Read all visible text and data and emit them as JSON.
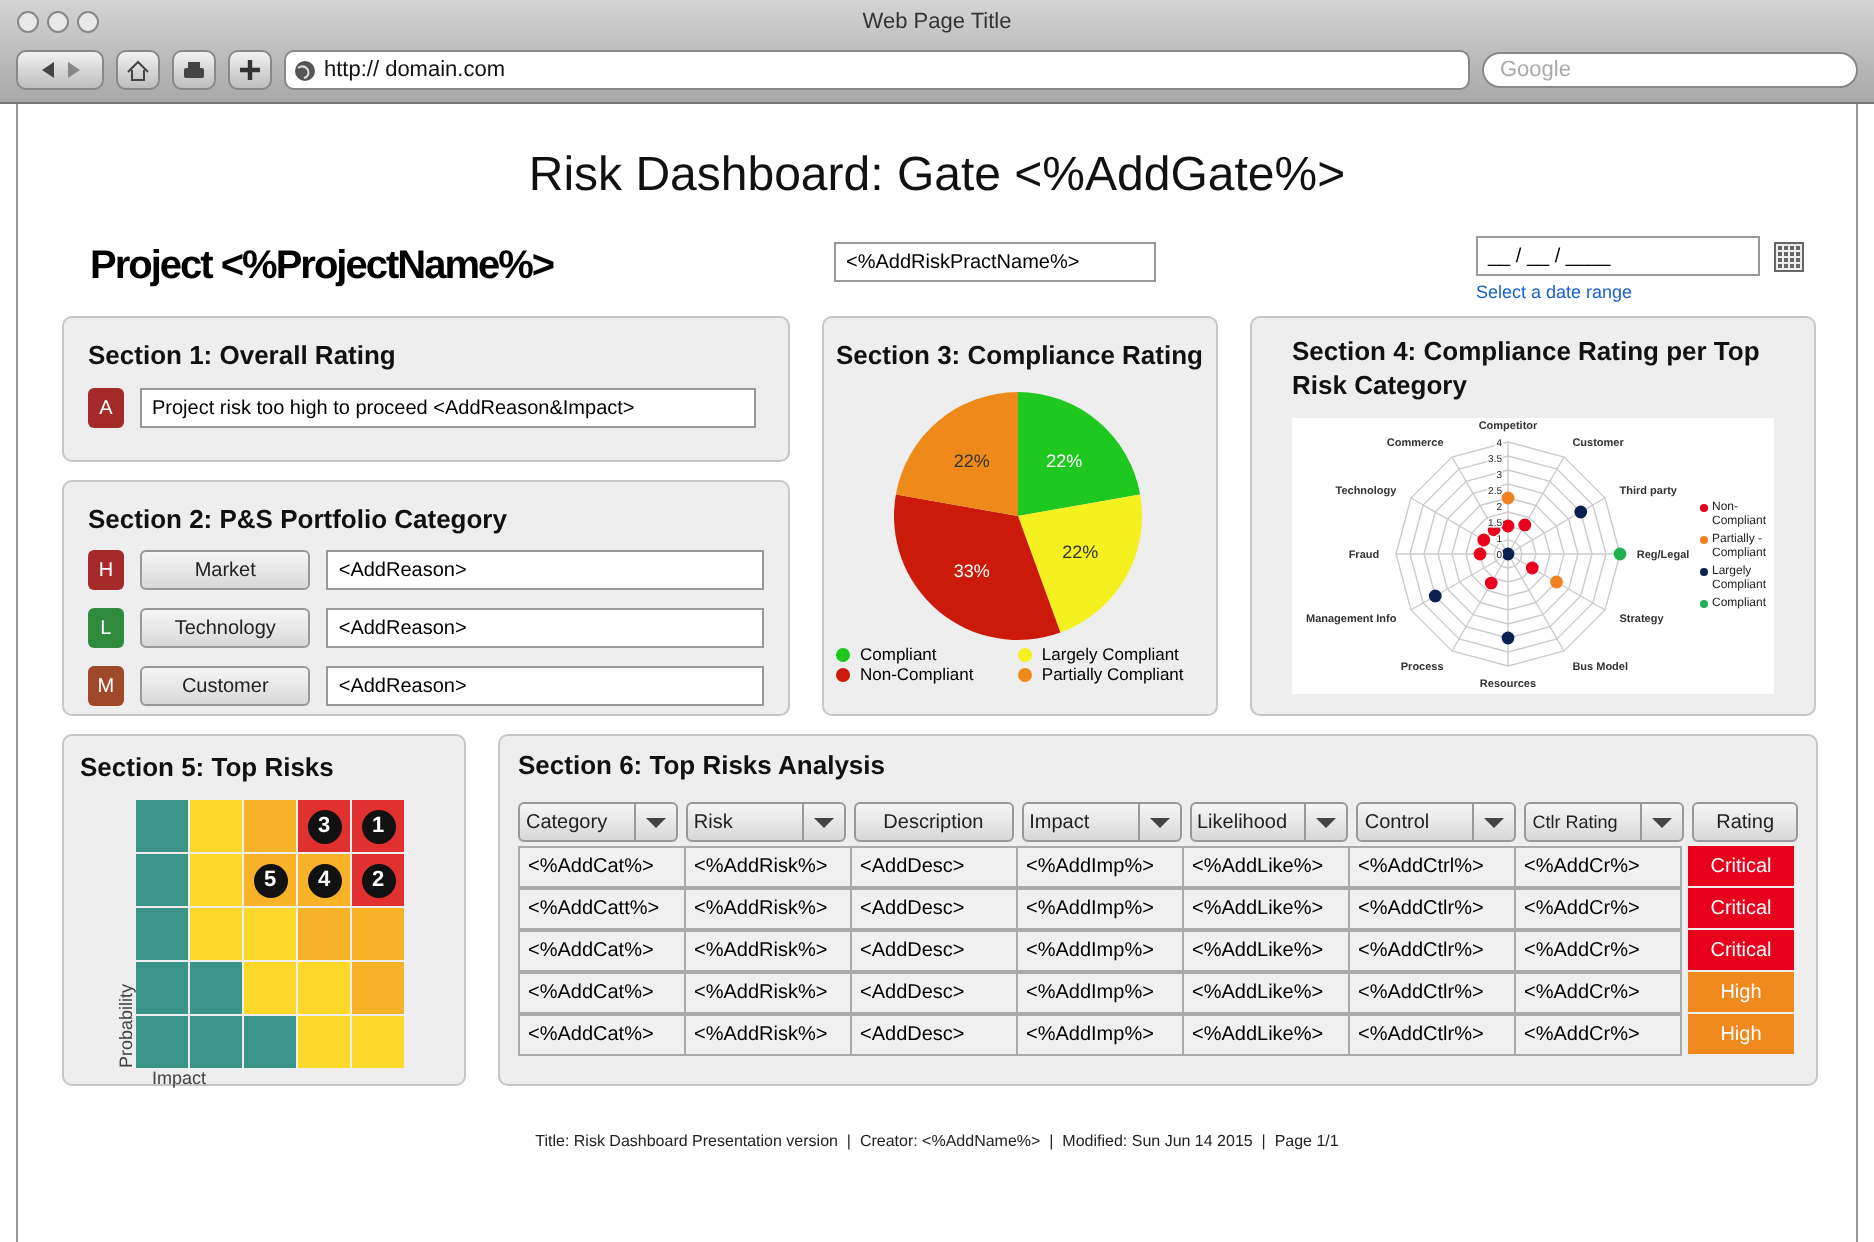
{
  "window": {
    "title": "Web Page Title"
  },
  "toolbar": {
    "url": "http:// domain.com",
    "search": {
      "placeholder": "Google"
    }
  },
  "page": {
    "title": "Risk Dashboard: Gate <%AddGate%>",
    "project": "Project <%ProjectName%>",
    "practitioner_field": {
      "value": "<%AddRiskPractName%>"
    },
    "date_field": {
      "value": "__ / __ / ____"
    },
    "date_link": "Select a date range"
  },
  "section1": {
    "title": "Section 1: Overall Rating",
    "badge": {
      "letter": "A",
      "color": "#a52a2a"
    },
    "field": {
      "value": "Project risk too high to proceed <AddReason&Impact>"
    }
  },
  "section2": {
    "title": "Section 2: P&S  Portfolio Category",
    "rows": [
      {
        "letter": "H",
        "color": "#a52a2a",
        "button": "Market",
        "value": "<AddReason>"
      },
      {
        "letter": "L",
        "color": "#2e8b3e",
        "button": "Technology",
        "value": "<AddReason>"
      },
      {
        "letter": "M",
        "color": "#a0482a",
        "button": "Customer",
        "value": "<AddReason>"
      }
    ]
  },
  "section3": {
    "title": "Section 3: Compliance Rating",
    "chart_data": {
      "type": "pie",
      "categories": [
        "Compliant",
        "Largely Compliant",
        "Non-Compliant",
        "Partially Compliant"
      ],
      "values": [
        22,
        22,
        33,
        22
      ],
      "colors": [
        "#1ec81e",
        "#f5f020",
        "#cc1a0a",
        "#ee8a1a"
      ],
      "value_labels": [
        "22%",
        "22%",
        "33%",
        "22%"
      ]
    }
  },
  "section4": {
    "title": "Section 4: Compliance Rating per Top Risk Category",
    "axes": [
      "Competitor",
      "Commerce",
      "Customer",
      "Technology",
      "Third party",
      "Fraud",
      "Reg/Legal",
      "Management Info",
      "Strategy",
      "Process",
      "Bus Model",
      "Resources"
    ],
    "ticks": [
      "4",
      "3.5",
      "3",
      "2.5",
      "2",
      "1.5",
      "1",
      "0"
    ],
    "legend": [
      {
        "label": "Non-Compliant",
        "color": "#e8001c"
      },
      {
        "label": "Partially - Compliant",
        "color": "#f08020"
      },
      {
        "label": "Largely Compliant",
        "color": "#0a2050"
      },
      {
        "label": "Compliant",
        "color": "#20b050"
      }
    ]
  },
  "section5": {
    "title": "Section 5: Top Risks",
    "x_label": "Impact",
    "y_label": "Probability",
    "cells": [
      {
        "color": "#3a9488"
      },
      {
        "color": "#fcd82a"
      },
      {
        "color": "#f8b228"
      },
      {
        "color": "#e03030",
        "marker": "3"
      },
      {
        "color": "#e03030",
        "marker": "1"
      },
      {
        "color": "#3a9488"
      },
      {
        "color": "#fcd82a"
      },
      {
        "color": "#f8b228",
        "marker": "5"
      },
      {
        "color": "#f8b228",
        "marker": "4"
      },
      {
        "color": "#e03030",
        "marker": "2"
      },
      {
        "color": "#3a9488"
      },
      {
        "color": "#fcd82a"
      },
      {
        "color": "#fcd82a"
      },
      {
        "color": "#f8b228"
      },
      {
        "color": "#f8b228"
      },
      {
        "color": "#3a9488"
      },
      {
        "color": "#3a9488"
      },
      {
        "color": "#fcd82a"
      },
      {
        "color": "#fcd82a"
      },
      {
        "color": "#f8b228"
      },
      {
        "color": "#3a9488"
      },
      {
        "color": "#3a9488"
      },
      {
        "color": "#3a9488"
      },
      {
        "color": "#fcd82a"
      },
      {
        "color": "#fcd82a"
      }
    ]
  },
  "section6": {
    "title": "Section 6: Top Risks Analysis",
    "columns": [
      {
        "label": "Category",
        "kind": "dropdown"
      },
      {
        "label": "Risk",
        "kind": "dropdown"
      },
      {
        "label": "Description",
        "kind": "button"
      },
      {
        "label": "Impact",
        "kind": "dropdown"
      },
      {
        "label": "Likelihood",
        "kind": "dropdown"
      },
      {
        "label": "Control",
        "kind": "dropdown"
      },
      {
        "label": "Ctlr Rating",
        "kind": "dropdown"
      },
      {
        "label": "Rating",
        "kind": "button"
      }
    ],
    "rows": [
      {
        "cells": [
          "<%AddCat%>",
          "<%AddRisk%>",
          "<AddDesc>",
          "<%AddImp%>",
          "<%AddLike%>",
          "<%AddCtrl%>",
          "<%AddCr%>"
        ],
        "rating": {
          "text": "Critical",
          "color": "#e8001c"
        }
      },
      {
        "cells": [
          "<%AddCatt%>",
          "<%AddRisk%>",
          "<AddDesc>",
          "<%AddImp%>",
          "<%AddLike%>",
          "<%AddCtlr%>",
          "<%AddCr%>"
        ],
        "rating": {
          "text": "Critical",
          "color": "#e8001c"
        }
      },
      {
        "cells": [
          "<%AddCat%>",
          "<%AddRisk%>",
          "<AddDesc>",
          "<%AddImp%>",
          "<%AddLike%>",
          "<%AddCtlr%>",
          "<%AddCr%>"
        ],
        "rating": {
          "text": "Critical",
          "color": "#e8001c"
        }
      },
      {
        "cells": [
          "<%AddCat%>",
          "<%AddRisk%>",
          "<AddDesc>",
          "<%AddImp%>",
          "<%AddLike%>",
          "<%AddCtlr%>",
          "<%AddCr%>"
        ],
        "rating": {
          "text": "High",
          "color": "#f0891e"
        }
      },
      {
        "cells": [
          "<%AddCat%>",
          "<%AddRisk%>",
          "<AddDesc>",
          "<%AddImp%>",
          "<%AddLike%>",
          "<%AddCtlr%>",
          "<%AddCr%>"
        ],
        "rating": {
          "text": "High",
          "color": "#f0891e"
        }
      }
    ]
  },
  "footer": "Title: Risk Dashboard Presentation version  |  Creator: <%AddName%>  |  Modified: Sun Jun 14 2015  |  Page 1/1"
}
